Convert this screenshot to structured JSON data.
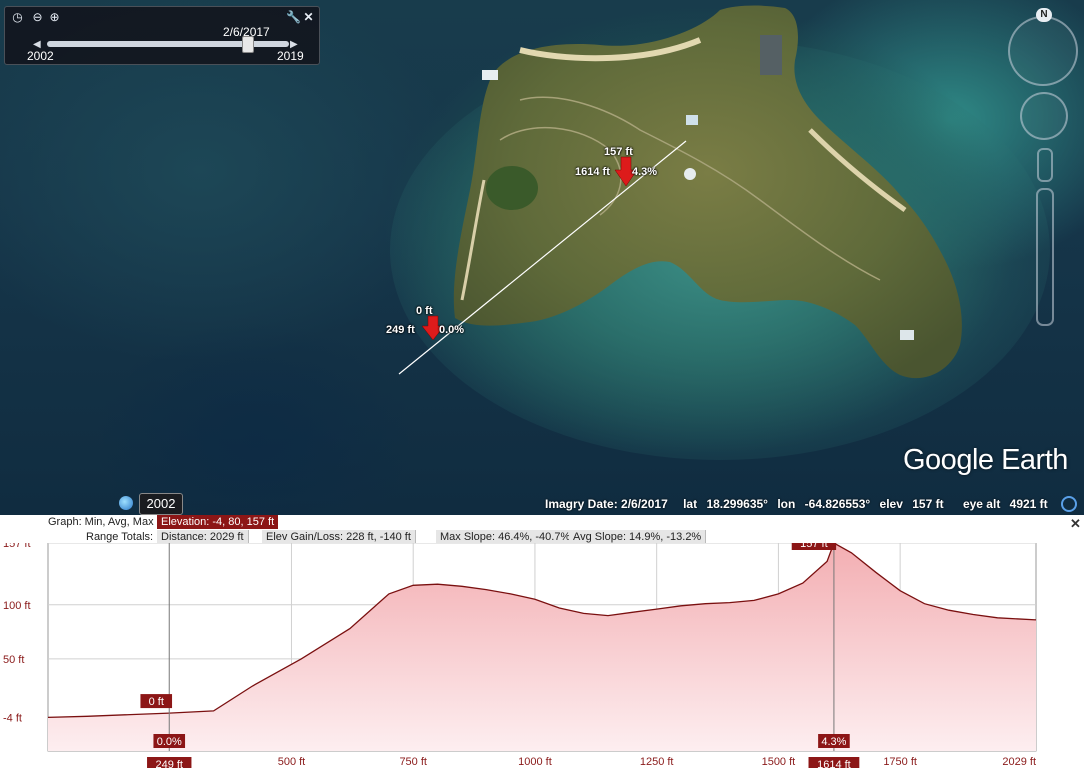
{
  "time_slider": {
    "current_date": "2/6/2017",
    "start_year": "2002",
    "end_year": "2019",
    "position_fraction": 0.83
  },
  "markers": [
    {
      "height": "0 ft",
      "distance": "249 ft",
      "slope": "0.0%"
    },
    {
      "height": "157 ft",
      "distance": "1614 ft",
      "slope": "4.3%"
    }
  ],
  "logo": "Google Earth",
  "status": {
    "imagery_date": "Imagry Date: 2/6/2017",
    "lat_label": "lat",
    "lat": "18.299635°",
    "lon_label": "lon",
    "lon": "-64.826553°",
    "elev_label": "elev",
    "elev": "157 ft",
    "eye_alt_label": "eye alt",
    "eye_alt": "4921 ft"
  },
  "year_button": "2002",
  "profile": {
    "graph_label": "Graph: Min, Avg, Max",
    "elevation": "Elevation: -4, 80, 157 ft",
    "range_totals_label": "Range Totals:",
    "distance": "Distance: 2029 ft",
    "elev_gain_loss": "Elev Gain/Loss: 228 ft, -140 ft",
    "max_slope": "Max Slope: 46.4%, -40.7%",
    "avg_slope": "Avg Slope: 14.9%, -13.2%"
  },
  "chart_data": {
    "type": "area",
    "x": [
      0,
      80,
      249,
      340,
      420,
      520,
      620,
      700,
      750,
      800,
      850,
      900,
      950,
      1000,
      1050,
      1100,
      1150,
      1200,
      1250,
      1300,
      1350,
      1400,
      1450,
      1500,
      1550,
      1600,
      1614,
      1650,
      1700,
      1750,
      1800,
      1850,
      1900,
      1950,
      2029
    ],
    "y": [
      -4,
      -3,
      0,
      2,
      25,
      50,
      78,
      110,
      118,
      119,
      117,
      114,
      110,
      105,
      97,
      92,
      90,
      93,
      96,
      99,
      101,
      102,
      104,
      110,
      120,
      140,
      157,
      148,
      130,
      113,
      101,
      95,
      91,
      88,
      86
    ],
    "y_ticks": [
      "157 ft",
      "100 ft",
      "50 ft",
      "-4 ft"
    ],
    "y_tick_values": [
      157,
      100,
      50,
      -4
    ],
    "x_ticks": [
      "500 ft",
      "750 ft",
      "1000 ft",
      "1250 ft",
      "1500 ft",
      "1750 ft",
      "2029 ft"
    ],
    "x_tick_values": [
      500,
      750,
      1000,
      1250,
      1500,
      1750,
      2029
    ],
    "ylim": [
      -35,
      157
    ],
    "xlim": [
      0,
      2029
    ],
    "grid": true,
    "marker_left": {
      "x": 249,
      "y_label": "0 ft",
      "x_label": "249 ft",
      "slope_label": "0.0%"
    },
    "marker_right": {
      "x": 1614,
      "y_label": "157 ft",
      "x_label": "1614 ft",
      "slope_label": "4.3%"
    }
  },
  "colors": {
    "profile_line": "#7a1010",
    "profile_fill_top": "#f3aeb2",
    "profile_fill_bottom": "#fdeef0",
    "accent_red": "#8c1616"
  }
}
